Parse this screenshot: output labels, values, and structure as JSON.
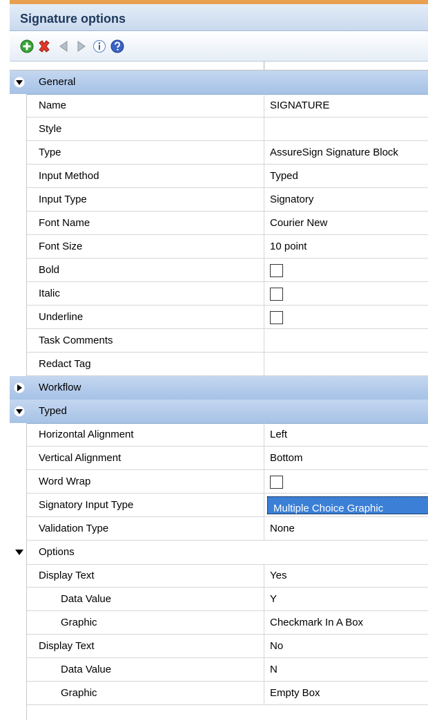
{
  "window": {
    "title": "Signature options"
  },
  "toolbar": {
    "buttons": [
      "add-icon",
      "delete-icon",
      "previous-icon",
      "next-icon",
      "info-icon",
      "help-icon"
    ]
  },
  "categories": {
    "general": "General",
    "workflow": "Workflow",
    "typed": "Typed",
    "options": "Options"
  },
  "general": {
    "name": {
      "label": "Name",
      "value": "SIGNATURE"
    },
    "style": {
      "label": "Style",
      "value": ""
    },
    "type": {
      "label": "Type",
      "value": "AssureSign Signature Block"
    },
    "input_method": {
      "label": "Input Method",
      "value": "Typed"
    },
    "input_type": {
      "label": "Input Type",
      "value": "Signatory"
    },
    "font_name": {
      "label": "Font Name",
      "value": "Courier New"
    },
    "font_size": {
      "label": "Font Size",
      "value": "10 point"
    },
    "bold": {
      "label": "Bold",
      "checked": false
    },
    "italic": {
      "label": "Italic",
      "checked": false
    },
    "underline": {
      "label": "Underline",
      "checked": false
    },
    "task_comments": {
      "label": "Task Comments",
      "value": ""
    },
    "redact_tag": {
      "label": "Redact Tag",
      "value": ""
    }
  },
  "typed": {
    "horizontal_alignment": {
      "label": "Horizontal Alignment",
      "value": "Left"
    },
    "vertical_alignment": {
      "label": "Vertical Alignment",
      "value": "Bottom"
    },
    "word_wrap": {
      "label": "Word Wrap",
      "checked": false
    },
    "signatory_input_type": {
      "label": "Signatory Input Type",
      "value": "Multiple Choice Graphic"
    },
    "validation_type": {
      "label": "Validation Type",
      "value": "None"
    }
  },
  "options": [
    {
      "display_label": "Display Text",
      "display_value": "Yes",
      "data_label": "Data Value",
      "data_value": "Y",
      "graphic_label": "Graphic",
      "graphic_value": "Checkmark In A Box"
    },
    {
      "display_label": "Display Text",
      "display_value": "No",
      "data_label": "Data Value",
      "data_value": "N",
      "graphic_label": "Graphic",
      "graphic_value": "Empty Box"
    }
  ],
  "colors": {
    "category_band": "#b3cbea",
    "selection": "#3b7fd6",
    "title_text": "#1e395b"
  }
}
